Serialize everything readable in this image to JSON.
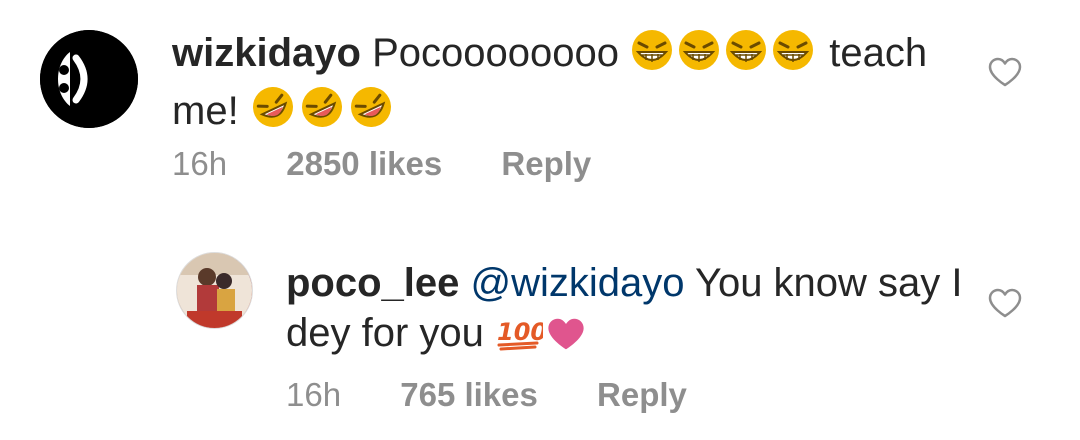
{
  "comments": [
    {
      "username": "wizkidayo",
      "text_part1": "Pocoooooooo",
      "text_part2": "teach",
      "text_part3": "me!",
      "time": "16h",
      "likes": "2850 likes",
      "reply_label": "Reply",
      "emojis": [
        "grinning-squint-face",
        "grinning-squint-face",
        "grinning-squint-face",
        "grinning-squint-face",
        "rofl-face",
        "rofl-face",
        "rofl-face"
      ]
    },
    {
      "username": "poco_lee",
      "mention": "@wizkidayo",
      "text_part1": "You know say",
      "text_part2": "I dey for you",
      "time": "16h",
      "likes": "765 likes",
      "reply_label": "Reply",
      "emojis": [
        "hundred-points",
        "pink-heart"
      ]
    }
  ],
  "colors": {
    "text": "#262626",
    "meta": "#8e8e8e",
    "mention": "#00376b",
    "emoji_yellow": "#f5b800",
    "heart_pink": "#e0558e",
    "hundred_red": "#e45a27"
  }
}
